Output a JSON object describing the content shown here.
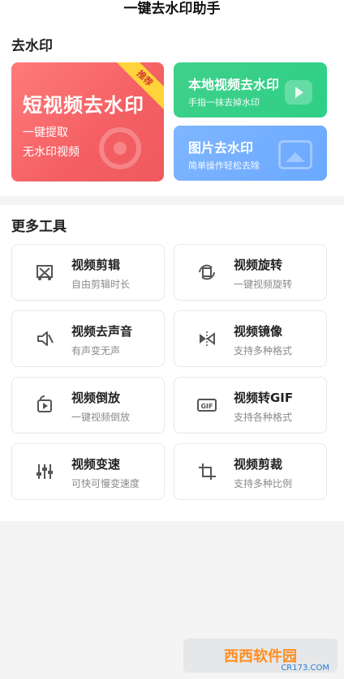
{
  "app": {
    "title": "一键去水印助手"
  },
  "sections": {
    "remove_watermark": "去水印",
    "more_tools": "更多工具"
  },
  "cards": {
    "short_video": {
      "title": "短视频去水印",
      "line1": "一键提取",
      "line2": "无水印视频",
      "ribbon": "推荐"
    },
    "local_video": {
      "title": "本地视频去水印",
      "sub": "手指一抹去掉水印"
    },
    "image": {
      "title": "图片去水印",
      "sub": "简单操作轻松去除"
    }
  },
  "tools": [
    {
      "name": "视频剪辑",
      "desc": "自由剪辑时长",
      "icon": "video-crop-icon"
    },
    {
      "name": "视频旋转",
      "desc": "一键视频旋转",
      "icon": "rotate-icon"
    },
    {
      "name": "视频去声音",
      "desc": "有声变无声",
      "icon": "mute-icon"
    },
    {
      "name": "视频镜像",
      "desc": "支持多种格式",
      "icon": "mirror-icon"
    },
    {
      "name": "视频倒放",
      "desc": "一键视频倒放",
      "icon": "reverse-play-icon"
    },
    {
      "name": "视频转GIF",
      "desc": "支持各种格式",
      "icon": "gif-icon"
    },
    {
      "name": "视频变速",
      "desc": "可快可慢变速度",
      "icon": "speed-sliders-icon"
    },
    {
      "name": "视频剪裁",
      "desc": "支持多种比例",
      "icon": "crop-icon"
    }
  ],
  "watermark": {
    "logo_text": "西西软件园",
    "url_text": "CR173.COM"
  },
  "colors": {
    "red_card": "#f45f63",
    "green_card": "#2fcf86",
    "blue_card": "#6aa8ff",
    "ribbon_yellow": "#ffd43b",
    "tool_border": "#e7e7e7"
  }
}
